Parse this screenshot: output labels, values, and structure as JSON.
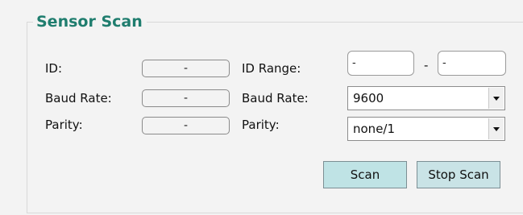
{
  "group": {
    "title": "Sensor Scan"
  },
  "left": {
    "id_label": "ID:",
    "id_value": "-",
    "baud_label": "Baud Rate:",
    "baud_value": "-",
    "parity_label": "Parity:",
    "parity_value": "-"
  },
  "right": {
    "id_range_label": "ID Range:",
    "id_range_from": "-",
    "id_range_sep": "-",
    "id_range_to": "-",
    "baud_label": "Baud Rate:",
    "baud_selected": "9600",
    "parity_label": "Parity:",
    "parity_selected": "none/1"
  },
  "buttons": {
    "scan": "Scan",
    "stop_scan": "Stop Scan"
  }
}
